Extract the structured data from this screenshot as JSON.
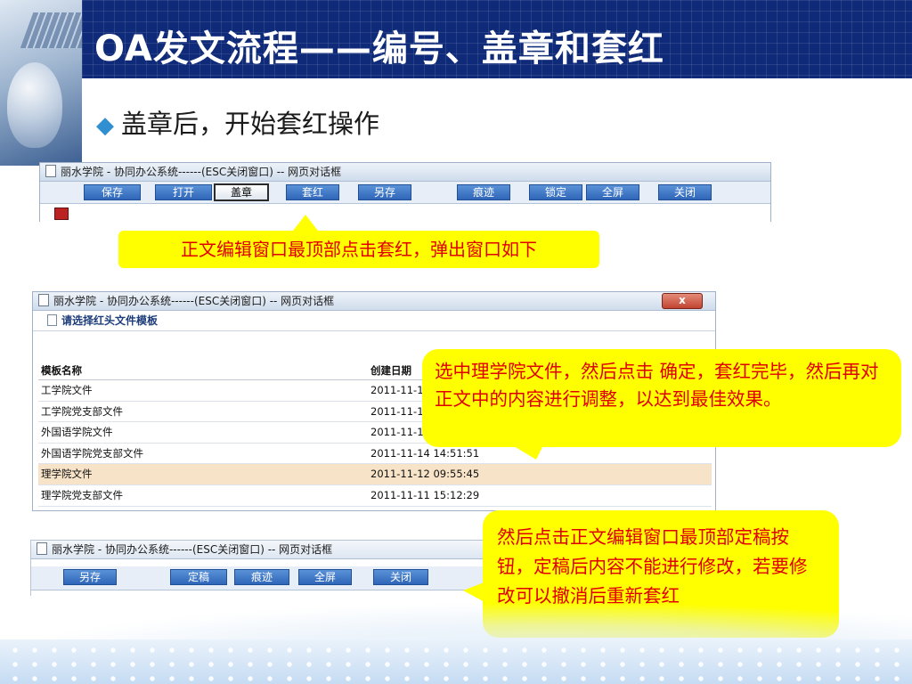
{
  "slide": {
    "title": "OA发文流程——编号、盖章和套红",
    "bullet": "盖章后，开始套红操作",
    "bullet_marker": "◆"
  },
  "dialog1": {
    "title": "丽水学院 - 协同办公系统------(ESC关闭窗口) -- 网页对话框",
    "buttons": [
      "保存",
      "打开",
      "盖章",
      "套红",
      "另存",
      "痕迹",
      "锁定",
      "全屏",
      "关闭"
    ],
    "active_button": "盖章"
  },
  "callout1": {
    "text": "正文编辑窗口最顶部点击套红，弹出窗口如下"
  },
  "dialog2": {
    "title": "丽水学院 - 协同办公系统------(ESC关闭窗口) -- 网页对话框",
    "close_label": "x",
    "header": "请选择红头文件模板",
    "columns": [
      "模板名称",
      "创建日期"
    ],
    "rows": [
      {
        "name": "工学院文件",
        "date": "2011-11-1"
      },
      {
        "name": "工学院党支部文件",
        "date": "2011-11-1"
      },
      {
        "name": "外国语学院文件",
        "date": "2011-11-1"
      },
      {
        "name": "外国语学院党支部文件",
        "date": "2011-11-14 14:51:51"
      },
      {
        "name": "理学院文件",
        "date": "2011-11-12 09:55:45"
      },
      {
        "name": "理学院党支部文件",
        "date": "2011-11-11 15:12:29"
      }
    ],
    "selected_row": "理学院文件"
  },
  "callout2": {
    "text": "选中理学院文件，然后点击 确定，套红完毕，然后再对正文中的内容进行调整，以达到最佳效果。"
  },
  "dialog3": {
    "title": "丽水学院 - 协同办公系统------(ESC关闭窗口) -- 网页对话框",
    "buttons": [
      "另存",
      "定稿",
      "痕迹",
      "全屏",
      "关闭"
    ]
  },
  "callout3": {
    "text": "然后点击正文编辑窗口最顶部定稿按钮，定稿后内容不能进行修改，若要修改可以撤消后重新套红"
  },
  "colors": {
    "header": "#0f2a78",
    "callout_bg": "#ffff00",
    "callout_text": "#e00000",
    "button": "#2f66b8",
    "selected_row": "#f7e3c8"
  }
}
